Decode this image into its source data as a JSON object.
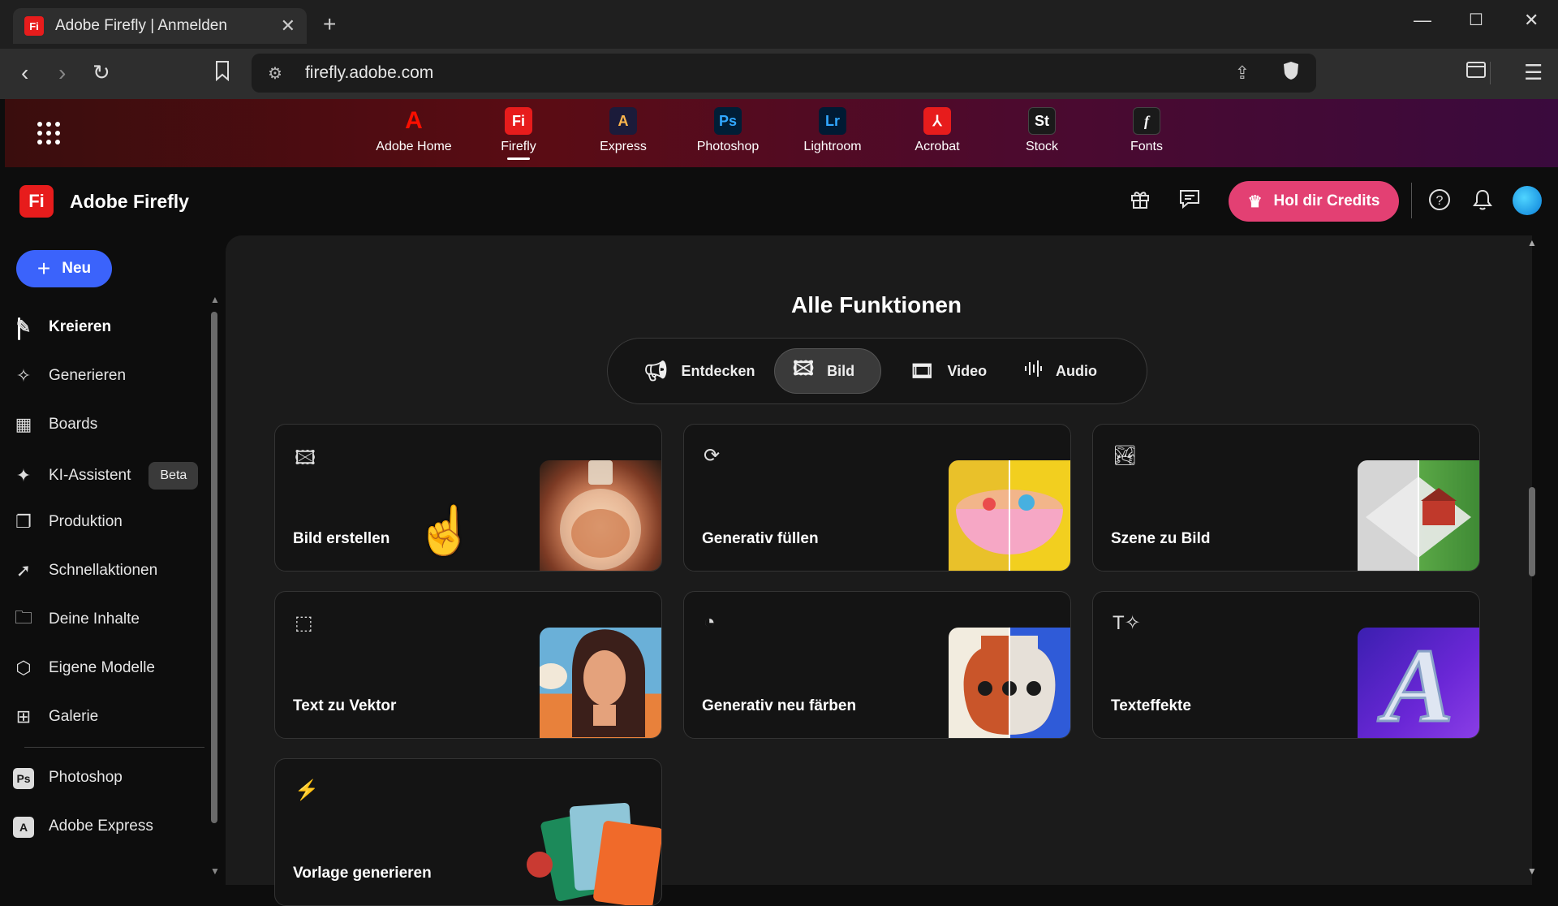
{
  "browser": {
    "tab_title": "Adobe Firefly | Anmelden",
    "tab_favicon": "Fi",
    "new_tab": "+",
    "url": "firefly.adobe.com"
  },
  "appbar": {
    "apps": [
      {
        "label": "Adobe Home",
        "glyph": "A",
        "bg": "transparent",
        "fg": "#fa0f00"
      },
      {
        "label": "Firefly",
        "glyph": "Fi",
        "bg": "#e71c1c",
        "fg": "#ffffff"
      },
      {
        "label": "Express",
        "glyph": "A",
        "bg": "#1b1b3a",
        "fg": "#ffcc33"
      },
      {
        "label": "Photoshop",
        "glyph": "Ps",
        "bg": "#001e36",
        "fg": "#31a8ff"
      },
      {
        "label": "Lightroom",
        "glyph": "Lr",
        "bg": "#001a33",
        "fg": "#31a8ff"
      },
      {
        "label": "Acrobat",
        "glyph": "⅄",
        "bg": "#e71c1c",
        "fg": "#ffffff"
      },
      {
        "label": "Stock",
        "glyph": "St",
        "bg": "#1a1a1a",
        "fg": "#ffffff"
      },
      {
        "label": "Fonts",
        "glyph": "f",
        "bg": "#1a1a1a",
        "fg": "#ffffff"
      }
    ],
    "active": "Firefly"
  },
  "header": {
    "brand_logo": "Fi",
    "brand_name": "Adobe Firefly",
    "credits_label": "Hol dir Credits",
    "accent": "#e34073"
  },
  "sidebar": {
    "new_label": "Neu",
    "items": [
      {
        "label": "Kreieren",
        "icon": "create-icon"
      },
      {
        "label": "Generieren",
        "icon": "generate-icon"
      },
      {
        "label": "Boards",
        "icon": "boards-icon"
      },
      {
        "label": "KI-Assistent",
        "icon": "ai-assistant-icon",
        "badge": "Beta"
      },
      {
        "label": "Produktion",
        "icon": "production-icon"
      },
      {
        "label": "Schnellaktionen",
        "icon": "quick-actions-icon"
      },
      {
        "label": "Deine Inhalte",
        "icon": "folder-icon"
      },
      {
        "label": "Eigene Modelle",
        "icon": "models-icon"
      },
      {
        "label": "Galerie",
        "icon": "gallery-icon"
      }
    ],
    "apps": [
      {
        "label": "Photoshop",
        "glyph": "Ps"
      },
      {
        "label": "Adobe Express",
        "glyph": "A"
      }
    ]
  },
  "main": {
    "title": "Alle Funktionen",
    "filters": [
      {
        "label": "Entdecken",
        "icon": "megaphone-icon"
      },
      {
        "label": "Bild",
        "icon": "image-icon",
        "selected": true
      },
      {
        "label": "Video",
        "icon": "film-icon"
      },
      {
        "label": "Audio",
        "icon": "waveform-icon"
      }
    ],
    "cards": [
      {
        "label": "Bild erstellen",
        "icon": "image-icon"
      },
      {
        "label": "Generativ füllen",
        "icon": "generative-fill-icon"
      },
      {
        "label": "Szene zu Bild",
        "icon": "scene-image-icon"
      },
      {
        "label": "Text zu Vektor",
        "icon": "vector-icon"
      },
      {
        "label": "Generativ neu färben",
        "icon": "recolor-icon"
      },
      {
        "label": "Texteffekte",
        "icon": "text-effects-icon"
      },
      {
        "label": "Vorlage generieren",
        "icon": "template-icon"
      }
    ]
  }
}
